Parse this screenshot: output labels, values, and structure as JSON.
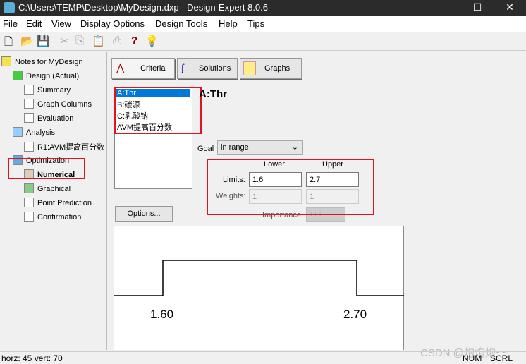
{
  "window": {
    "title": "C:\\Users\\TEMP\\Desktop\\MyDesign.dxp - Design-Expert 8.0.6",
    "minimize": "—",
    "maximize": "☐",
    "close": "✕"
  },
  "menu": [
    "File",
    "Edit",
    "View",
    "Display Options",
    "Design Tools",
    "Help",
    "Tips"
  ],
  "toolbar": [
    "new-icon",
    "open-icon",
    "save-icon",
    "cut-icon",
    "copy-icon",
    "paste-icon",
    "print-icon",
    "help-icon",
    "tip-icon"
  ],
  "tree": {
    "root": "Notes for MyDesign",
    "items": [
      {
        "label": "Design (Actual)",
        "level": 1
      },
      {
        "label": "Summary",
        "level": 2
      },
      {
        "label": "Graph Columns",
        "level": 2
      },
      {
        "label": "Evaluation",
        "level": 2
      },
      {
        "label": "Analysis",
        "level": 1
      },
      {
        "label": "R1:AVM提高百分数",
        "level": 2
      },
      {
        "label": "Optimization",
        "level": 1
      },
      {
        "label": "Numerical",
        "level": 2,
        "selected": true
      },
      {
        "label": "Graphical",
        "level": 2
      },
      {
        "label": "Point Prediction",
        "level": 2
      },
      {
        "label": "Confirmation",
        "level": 2
      }
    ]
  },
  "tabs": [
    "Criteria",
    "Solutions",
    "Graphs"
  ],
  "factors": [
    "A:Thr",
    "B:碳源",
    "C:乳酸钠",
    "AVM提高百分数"
  ],
  "selected_factor": "A:Thr",
  "goal": {
    "label": "Goal",
    "value": "in range"
  },
  "limits": {
    "lower_header": "Lower",
    "upper_header": "Upper",
    "limits_label": "Limits:",
    "lower": "1.6",
    "upper": "2.7",
    "weights_label": "Weights:",
    "lower_weight": "1",
    "upper_weight": "1",
    "importance_label": "Importance:",
    "importance": "+++"
  },
  "options_button": "Options...",
  "graph": {
    "lower_label": "1.60",
    "upper_label": "2.70"
  },
  "status": {
    "left": "horz: 45  vert: 70",
    "num": "NUM",
    "scrl": "SCRL"
  },
  "watermark": "CSDN @炮炮炮~~",
  "colors": {
    "accent": "#0078d7",
    "annotation": "#e0141e"
  }
}
